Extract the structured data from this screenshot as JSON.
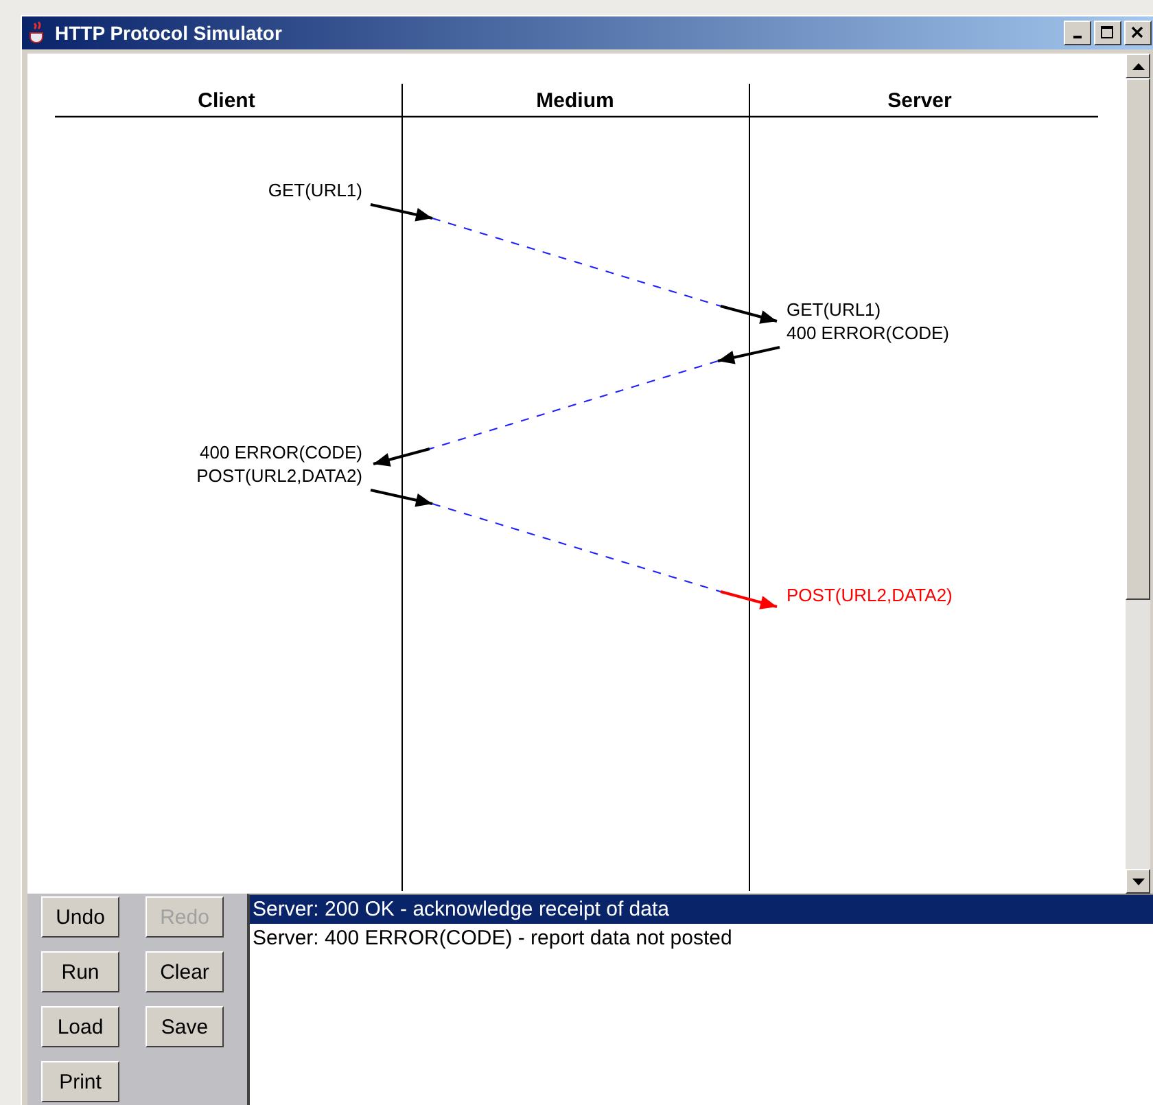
{
  "window": {
    "title": "HTTP Protocol Simulator"
  },
  "diagram": {
    "columns": [
      "Client",
      "Medium",
      "Server"
    ],
    "messages": [
      {
        "kind": "request",
        "sender_label": "GET(URL1)",
        "receiver_label": "GET(URL1)",
        "current": false
      },
      {
        "kind": "response",
        "sender_label": "400 ERROR(CODE)",
        "receiver_label": "400 ERROR(CODE)",
        "current": false
      },
      {
        "kind": "request",
        "sender_label": "POST(URL2,DATA2)",
        "receiver_label": "POST(URL2,DATA2)",
        "current": true
      }
    ]
  },
  "buttons": [
    {
      "label": "Undo",
      "disabled": false
    },
    {
      "label": "Redo",
      "disabled": true
    },
    {
      "label": "Run",
      "disabled": false
    },
    {
      "label": "Clear",
      "disabled": false
    },
    {
      "label": "Load",
      "disabled": false
    },
    {
      "label": "Save",
      "disabled": false
    },
    {
      "label": "Print",
      "disabled": false
    }
  ],
  "log": [
    {
      "text": "Server: 200 OK - acknowledge receipt of data",
      "selected": true
    },
    {
      "text": "Server: 400 ERROR(CODE) - report data not posted",
      "selected": false
    }
  ]
}
